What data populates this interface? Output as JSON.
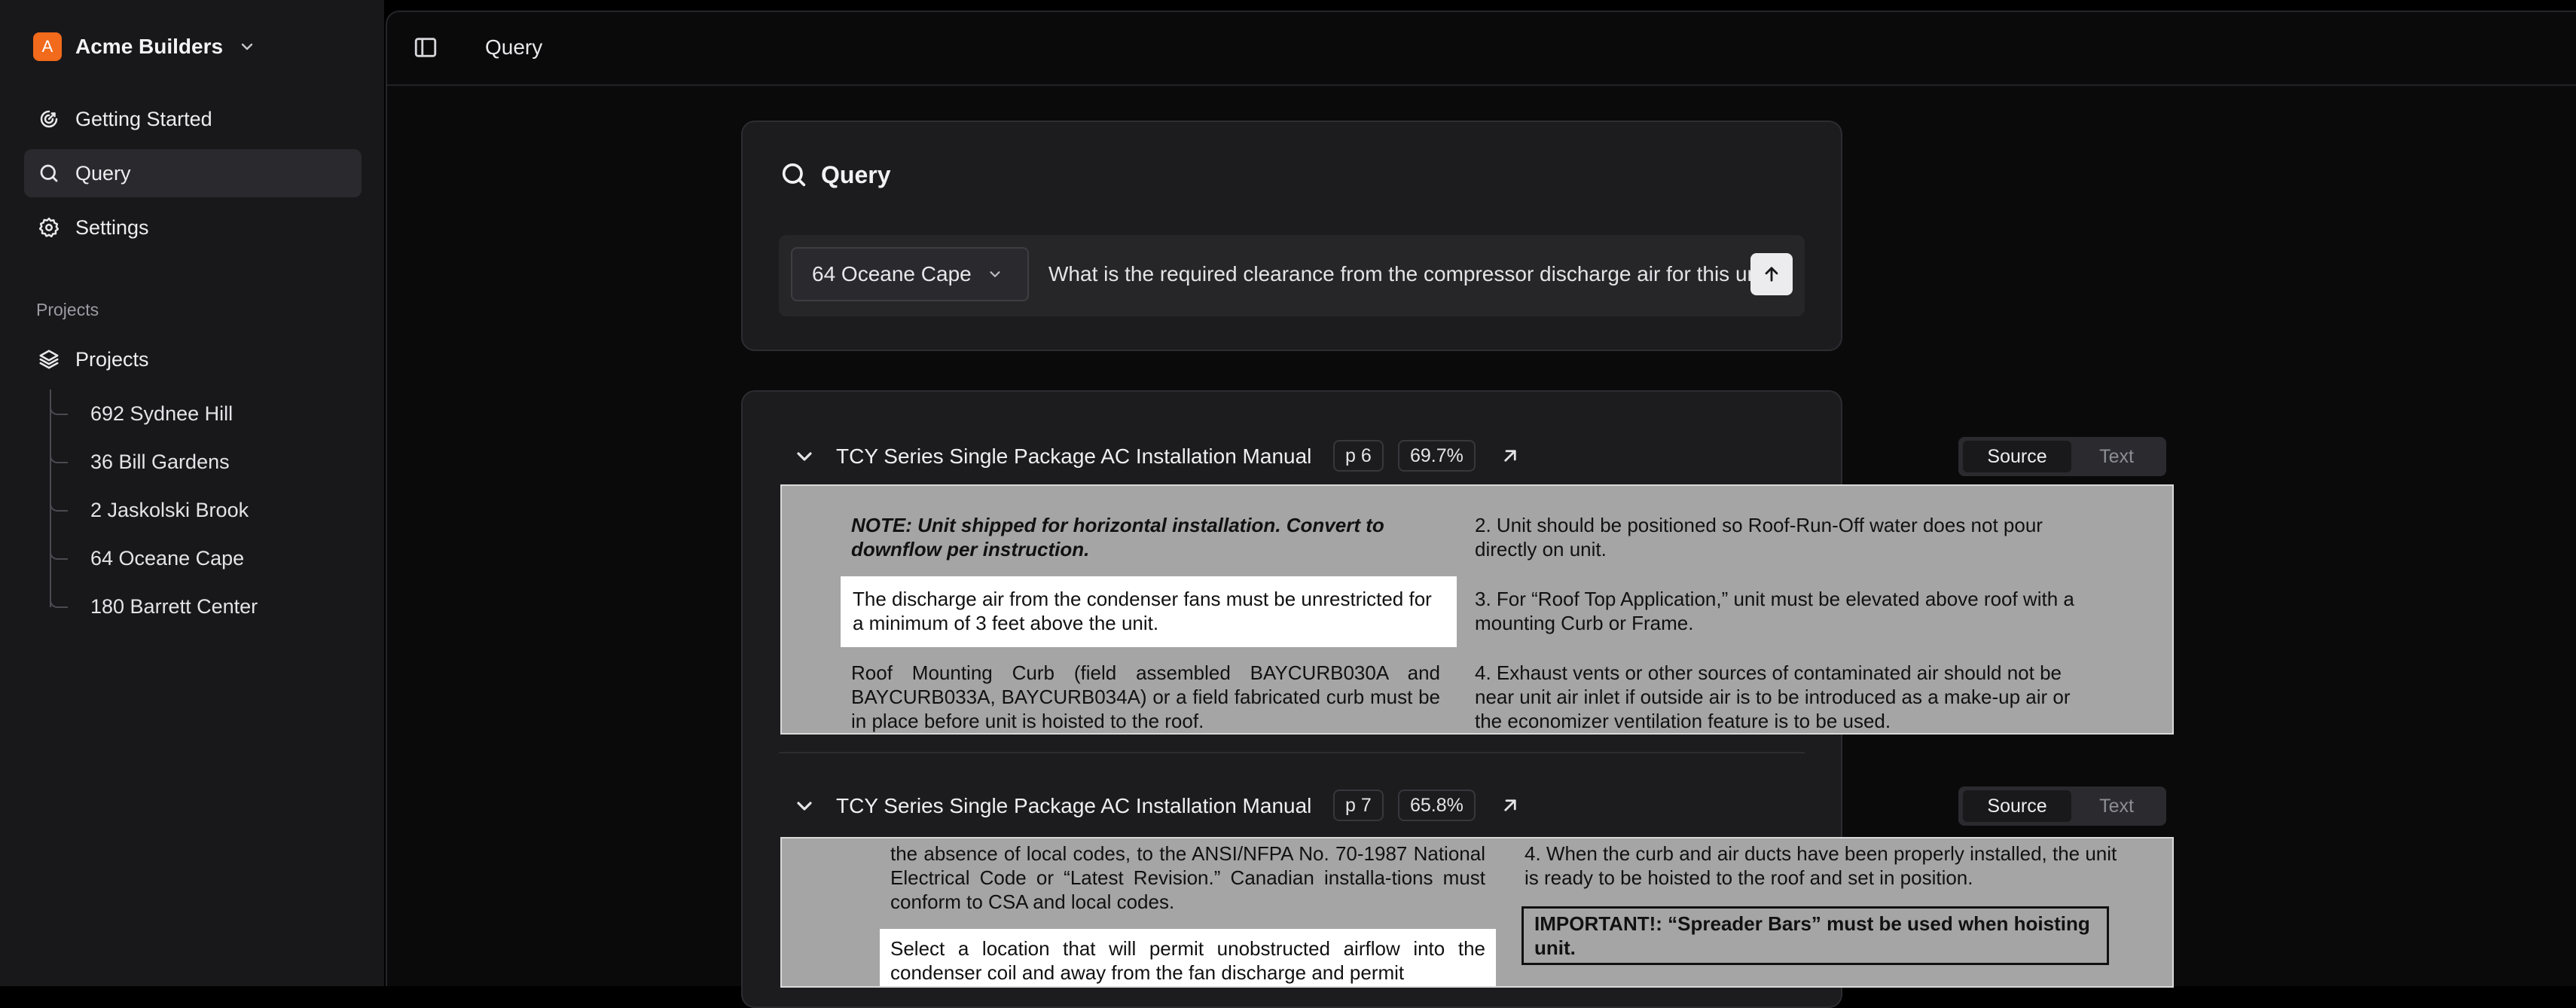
{
  "sidebar": {
    "brand": {
      "badge": "A",
      "name": "Acme Builders",
      "badge_color": "#f26a1b"
    },
    "nav": [
      {
        "label": "Getting Started",
        "icon": "rocket-icon",
        "active": false
      },
      {
        "label": "Query",
        "icon": "search-icon",
        "active": true
      },
      {
        "label": "Settings",
        "icon": "gear-icon",
        "active": false
      }
    ],
    "section_label": "Projects",
    "projects_header": {
      "label": "Projects",
      "icon": "layers-icon"
    },
    "projects": [
      {
        "label": "692 Sydnee Hill"
      },
      {
        "label": "36 Bill Gardens"
      },
      {
        "label": "2 Jaskolski Brook"
      },
      {
        "label": "64 Oceane Cape"
      },
      {
        "label": "180 Barrett Center"
      }
    ]
  },
  "topbar": {
    "breadcrumb": "Query",
    "toggle_icon": "sidebar-toggle-icon"
  },
  "query": {
    "title": "Query",
    "project_select": "64 Oceane Cape",
    "question": "What is the required clearance from the compressor discharge air for this unit?",
    "send_icon": "arrow-up-icon"
  },
  "results": [
    {
      "title": "TCY Series Single Package AC Installation Manual",
      "page": "p 6",
      "score": "69.7%",
      "toggle": {
        "source": "Source",
        "text": "Text",
        "selected": "Source"
      },
      "excerpt": {
        "left_note": "NOTE: Unit shipped for horizontal installation. Convert to downflow per instruction.",
        "highlight": "The discharge air from the condenser fans must be unrestricted for a minimum of 3 feet above the unit.",
        "left_para": "Roof Mounting Curb (field assembled BAYCURB030A and BAYCURB033A, BAYCURB034A) or a field fabricated curb must be in place before unit is hoisted to the roof.",
        "item2": "2. Unit should be positioned so Roof-Run-Off water does not pour directly on unit.",
        "item3": "3. For “Roof Top Application,” unit must be elevated above roof with a mounting Curb or Frame.",
        "item4": "4. Exhaust vents or other sources of contaminated air should not be near unit air inlet if outside air is to be introduced as a make-up air or the economizer ventilation feature is to be used."
      }
    },
    {
      "title": "TCY Series Single Package AC Installation Manual",
      "page": "p 7",
      "score": "65.8%",
      "toggle": {
        "source": "Source",
        "text": "Text",
        "selected": "Source"
      },
      "excerpt": {
        "left_para": "the absence of local codes, to the ANSI/NFPA No. 70-1987 National Electrical Code or “Latest Revision.” Canadian installa-tions must conform to CSA and local codes.",
        "highlight": "Select a location that will permit unobstructed airflow into the condenser coil and away from the fan discharge and permit",
        "item4": "4. When the curb and air ducts have been properly installed, the unit is ready to be hoisted to the roof and set in position.",
        "important": "IMPORTANT!: “Spreader Bars” must be used when hoisting unit."
      }
    }
  ]
}
